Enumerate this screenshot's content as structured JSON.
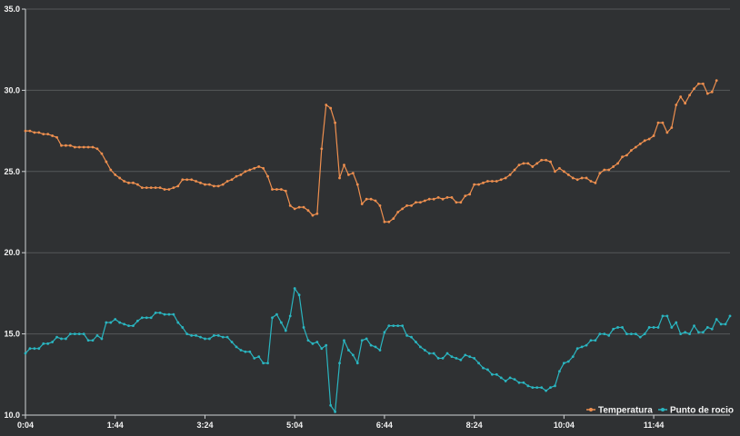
{
  "chart_data": {
    "type": "line",
    "ylim": [
      10.0,
      35.0
    ],
    "yticks": [
      "35.0",
      "30.0",
      "25.0",
      "20.0",
      "15.0",
      "10.0"
    ],
    "xticks": [
      "0:04",
      "1:44",
      "3:24",
      "5:04",
      "6:44",
      "8:24",
      "10:04",
      "11:44"
    ],
    "x_start": "0:04",
    "x_step_minutes": 5,
    "grid": true,
    "legend_position": "bottom-right",
    "series": [
      {
        "name": "Temperatura",
        "color": "#ee8f4f",
        "values": [
          27.5,
          27.5,
          27.4,
          27.4,
          27.3,
          27.3,
          27.2,
          27.1,
          26.6,
          26.6,
          26.6,
          26.5,
          26.5,
          26.5,
          26.5,
          26.5,
          26.4,
          26.1,
          25.6,
          25.1,
          24.8,
          24.6,
          24.4,
          24.3,
          24.3,
          24.2,
          24.0,
          24.0,
          24.0,
          24.0,
          24.0,
          23.9,
          23.9,
          24.0,
          24.1,
          24.5,
          24.5,
          24.5,
          24.4,
          24.3,
          24.2,
          24.2,
          24.1,
          24.1,
          24.2,
          24.4,
          24.5,
          24.7,
          24.8,
          25.0,
          25.1,
          25.2,
          25.3,
          25.2,
          24.7,
          23.9,
          23.9,
          23.9,
          23.8,
          22.9,
          22.7,
          22.8,
          22.8,
          22.6,
          22.3,
          22.4,
          26.4,
          29.1,
          28.9,
          28.0,
          24.6,
          25.4,
          24.8,
          24.9,
          24.2,
          23.0,
          23.3,
          23.3,
          23.2,
          22.9,
          21.9,
          21.9,
          22.1,
          22.5,
          22.7,
          22.9,
          22.9,
          23.1,
          23.1,
          23.2,
          23.3,
          23.3,
          23.4,
          23.3,
          23.4,
          23.4,
          23.1,
          23.1,
          23.5,
          23.6,
          24.2,
          24.2,
          24.3,
          24.4,
          24.4,
          24.4,
          24.5,
          24.6,
          24.8,
          25.1,
          25.4,
          25.5,
          25.5,
          25.3,
          25.5,
          25.7,
          25.7,
          25.6,
          25.0,
          25.2,
          25.0,
          24.8,
          24.6,
          24.5,
          24.6,
          24.6,
          24.4,
          24.3,
          24.9,
          25.1,
          25.1,
          25.3,
          25.5,
          25.9,
          26.0,
          26.3,
          26.5,
          26.7,
          26.9,
          27.0,
          27.2,
          28.0,
          28.0,
          27.4,
          27.7,
          29.1,
          29.6,
          29.2,
          29.7,
          30.1,
          30.4,
          30.4,
          29.8,
          29.9,
          30.6
        ]
      },
      {
        "name": "Punto de rocio",
        "color": "#2ab5c0",
        "values": [
          13.8,
          14.1,
          14.1,
          14.1,
          14.4,
          14.4,
          14.5,
          14.8,
          14.7,
          14.7,
          15.0,
          15.0,
          15.0,
          15.0,
          14.6,
          14.6,
          14.9,
          14.7,
          15.7,
          15.7,
          15.9,
          15.7,
          15.6,
          15.5,
          15.5,
          15.8,
          16.0,
          16.0,
          16.0,
          16.3,
          16.3,
          16.2,
          16.2,
          16.2,
          15.7,
          15.4,
          15.0,
          14.9,
          14.9,
          14.8,
          14.7,
          14.7,
          14.9,
          14.9,
          14.8,
          14.8,
          14.5,
          14.2,
          14.0,
          13.9,
          13.9,
          13.5,
          13.6,
          13.2,
          13.2,
          16.0,
          16.2,
          15.7,
          15.2,
          16.1,
          17.8,
          17.4,
          15.4,
          14.6,
          14.4,
          14.5,
          14.1,
          14.3,
          10.6,
          10.2,
          13.2,
          14.6,
          14.0,
          13.7,
          13.2,
          14.6,
          14.7,
          14.3,
          14.2,
          14.0,
          15.1,
          15.5,
          15.5,
          15.5,
          15.5,
          14.9,
          14.8,
          14.5,
          14.2,
          14.0,
          13.8,
          13.8,
          13.5,
          13.5,
          13.8,
          13.6,
          13.5,
          13.4,
          13.7,
          13.6,
          13.5,
          13.2,
          12.9,
          12.8,
          12.5,
          12.5,
          12.3,
          12.1,
          12.3,
          12.2,
          12.0,
          12.0,
          11.8,
          11.7,
          11.7,
          11.7,
          11.5,
          11.7,
          11.8,
          12.7,
          13.2,
          13.3,
          13.6,
          14.1,
          14.2,
          14.3,
          14.6,
          14.6,
          15.0,
          15.0,
          14.9,
          15.3,
          15.4,
          15.4,
          15.0,
          15.0,
          15.0,
          14.8,
          15.0,
          15.4,
          15.4,
          15.4,
          16.1,
          16.1,
          15.4,
          15.7,
          15.0,
          15.1,
          15.0,
          15.5,
          15.1,
          15.1,
          15.4,
          15.3,
          15.9,
          15.6,
          15.6,
          16.1
        ]
      }
    ]
  }
}
